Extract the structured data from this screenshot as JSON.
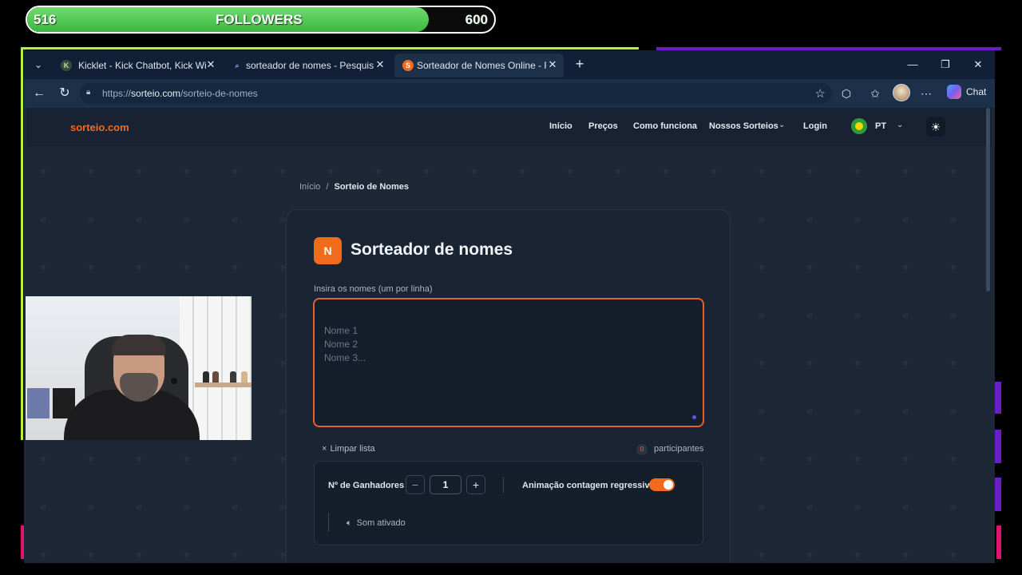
{
  "followers": {
    "current": "516",
    "label": "FOLLOWERS",
    "goal": "600",
    "progress": 0.86
  },
  "tabs": [
    {
      "title": "Kicklet - Kick Chatbot, Kick Widget",
      "icon": "kicklet-favicon",
      "active": false
    },
    {
      "title": "sorteador de nomes - Pesquisar",
      "icon": "search-favicon",
      "active": false
    },
    {
      "title": "Sorteador de Nomes Online - Rápido",
      "icon": "sorteio-favicon",
      "active": true
    }
  ],
  "address": {
    "url_prefix": "https://",
    "url_host": "sorteio.com",
    "url_path": "/sorteio-de-nomes"
  },
  "toolbar": {
    "chat_label": "Chat"
  },
  "site": {
    "brand": "sorteio.com",
    "nav": {
      "inicio": "Início",
      "precos": "Preços",
      "como": "Como funciona",
      "sorteios": "Nossos Sorteios",
      "login": "Login",
      "lang": "PT"
    }
  },
  "breadcrumb": {
    "home": "Início",
    "sep": "/",
    "current": "Sorteio de Nomes"
  },
  "card": {
    "badge": "N",
    "title": "Sorteador de nomes",
    "input_label": "Insira os nomes (um por linha)",
    "placeholder": "Nome 1\nNome 2\nNome 3...",
    "clear_label": "Limpar lista",
    "participants_count": "0",
    "participants_label": "participantes",
    "winners_label": "Nº de Ganhadores",
    "winners_value": "1",
    "minus": "−",
    "plus": "+",
    "anim_label": "Animação contagem regressiva",
    "anim_on": true,
    "sound_label": "Som ativado"
  },
  "colors": {
    "accent": "#f26b1d",
    "page_bg": "#1d2736",
    "tab_bar": "#112036",
    "follow_fill": "#3cb73f"
  }
}
